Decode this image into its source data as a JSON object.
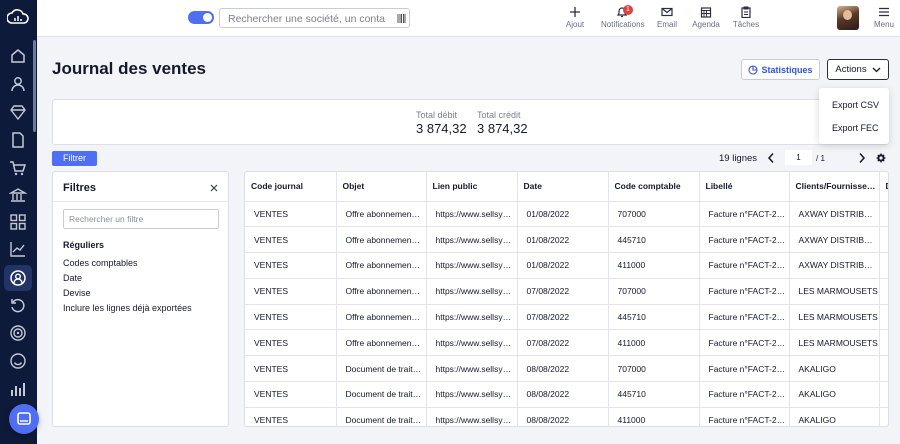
{
  "topbar": {
    "search_placeholder": "Rechercher une société, un contact",
    "actions": [
      {
        "label": "Ajout",
        "icon": "plus-icon"
      },
      {
        "label": "Notifications",
        "icon": "bell-icon",
        "badge": "1"
      },
      {
        "label": "Email",
        "icon": "envelope-icon"
      },
      {
        "label": "Agenda",
        "icon": "calendar-icon"
      },
      {
        "label": "Tâches",
        "icon": "clipboard-icon"
      },
      {
        "label": "Menu",
        "icon": "hamburger-icon"
      }
    ]
  },
  "sidebar": {
    "icons": [
      "logo-icon",
      "home-icon",
      "contact-icon",
      "gem-icon",
      "document-icon",
      "cart-icon",
      "bank-icon",
      "apps-icon",
      "chart-line-icon",
      "accounting-icon",
      "history-icon",
      "target-icon",
      "smiley-icon",
      "bar-chart-icon"
    ],
    "active": "accounting-icon"
  },
  "page": {
    "title": "Journal des ventes",
    "stats_button": "Statistiques",
    "actions_button": "Actions",
    "actions_menu": [
      "Export CSV",
      "Export FEC"
    ]
  },
  "totals": {
    "debit_label": "Total débit",
    "debit_value": "3 874,32",
    "credit_label": "Total crédit",
    "credit_value": "3 874,32"
  },
  "toolbar": {
    "filter_button": "Filtrer",
    "lines_count": "19 lignes",
    "current_page": "1",
    "total_pages": "/ 1"
  },
  "filters": {
    "title": "Filtres",
    "search_placeholder": "Rechercher un filtre",
    "section": "Réguliers",
    "items": [
      "Codes comptables",
      "Date",
      "Devise",
      "Inclure les lignes déjà exportées"
    ]
  },
  "table": {
    "columns": [
      "Code journal",
      "Objet",
      "Lien public",
      "Date",
      "Code comptable",
      "Libellé",
      "Clients/Fournisse…",
      "D"
    ],
    "rows": [
      [
        "VENTES",
        "Offre abonnemen…",
        "https://www.sellsy…",
        "01/08/2022",
        "707000",
        "Facture n°FACT-2…",
        "AXWAY DISTRIBU…",
        ""
      ],
      [
        "VENTES",
        "Offre abonnemen…",
        "https://www.sellsy…",
        "01/08/2022",
        "445710",
        "Facture n°FACT-2…",
        "AXWAY DISTRIBU…",
        ""
      ],
      [
        "VENTES",
        "Offre abonnemen…",
        "https://www.sellsy…",
        "01/08/2022",
        "411000",
        "Facture n°FACT-2…",
        "AXWAY DISTRIBU…",
        ""
      ],
      [
        "VENTES",
        "Offre abonnemen…",
        "https://www.sellsy…",
        "07/08/2022",
        "707000",
        "Facture n°FACT-2…",
        "LES MARMOUSETS",
        ""
      ],
      [
        "VENTES",
        "Offre abonnemen…",
        "https://www.sellsy…",
        "07/08/2022",
        "445710",
        "Facture n°FACT-2…",
        "LES MARMOUSETS",
        ""
      ],
      [
        "VENTES",
        "Offre abonnemen…",
        "https://www.sellsy…",
        "07/08/2022",
        "411000",
        "Facture n°FACT-2…",
        "LES MARMOUSETS",
        ""
      ],
      [
        "VENTES",
        "Document de trait…",
        "https://www.sellsy…",
        "08/08/2022",
        "707000",
        "Facture n°FACT-2…",
        "AKALIGO",
        ""
      ],
      [
        "VENTES",
        "Document de trait…",
        "https://www.sellsy…",
        "08/08/2022",
        "445710",
        "Facture n°FACT-2…",
        "AKALIGO",
        ""
      ],
      [
        "VENTES",
        "Document de trait…",
        "https://www.sellsy…",
        "08/08/2022",
        "411000",
        "Facture n°FACT-2…",
        "AKALIGO",
        ""
      ]
    ]
  },
  "colors": {
    "accent": "#4f6ef2",
    "sidebar_bg": "#0d1a3a",
    "badge": "#e0413b"
  }
}
